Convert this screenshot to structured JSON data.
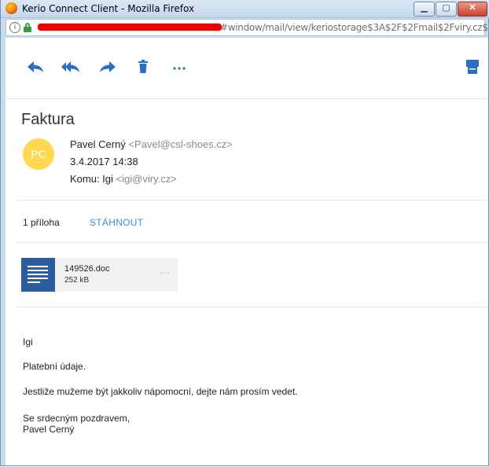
{
  "window": {
    "title": "Kerio Connect Client - Mozilla Firefox",
    "url_tail": "#window/mail/view/keriostorage$3A$2F$2Fmail$2Fviry.cz$"
  },
  "toolbar": {
    "icons": [
      "reply-icon",
      "reply-all-icon",
      "forward-icon",
      "delete-icon",
      "more-icon",
      "print-icon"
    ]
  },
  "message": {
    "subject": "Faktura",
    "avatar_initials": "PC",
    "sender_name": "Pavel Cerný",
    "sender_email": "<Pavel@csl-shoes.cz>",
    "date": "3.4.2017 14:38",
    "to_label": "Komu: Igi",
    "to_email": "<igi@viry.cz>",
    "attachment_count": "1 příloha",
    "download_label": "STÁHNOUT",
    "attachment": {
      "name": "149526.doc",
      "size": "252 kB",
      "more": "..."
    },
    "body": {
      "greeting": "Igi",
      "line1": "Platební údaje.",
      "line2": "Jestliže mužeme být jakkoliv nápomocní, dejte nám prosím vedet.",
      "closing": "Se srdecným pozdravem,",
      "signature": "Pavel Cerný"
    }
  },
  "colors": {
    "accent": "#2a6fc4",
    "avatar": "#ffd84d",
    "link": "#3b8ed7",
    "doc_icon": "#2a5ca0"
  }
}
